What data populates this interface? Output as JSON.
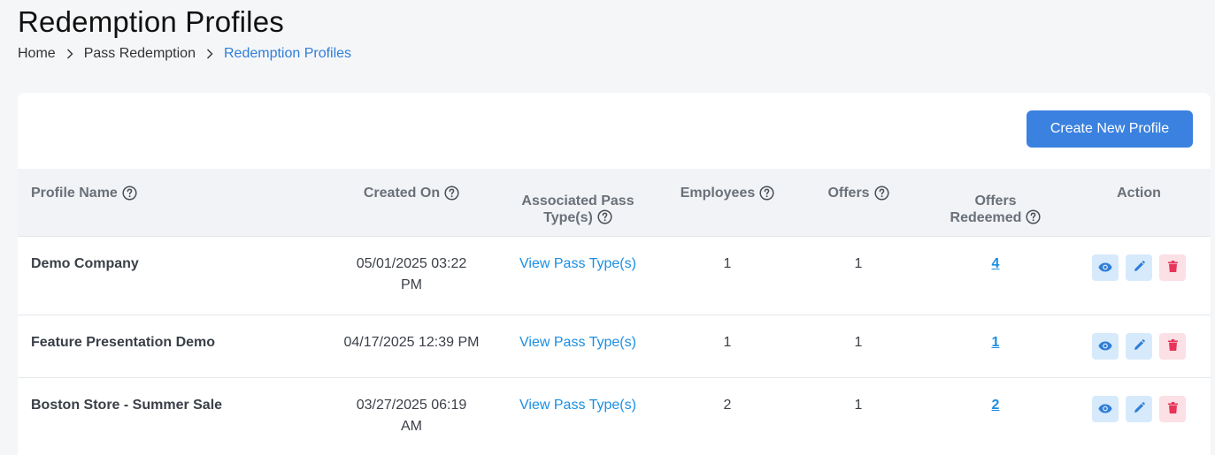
{
  "header": {
    "title": "Redemption Profiles",
    "breadcrumb": [
      "Home",
      "Pass Redemption",
      "Redemption Profiles"
    ]
  },
  "toolbar": {
    "create_label": "Create New Profile"
  },
  "table": {
    "columns": {
      "profile_name": "Profile Name",
      "created_on": "Created On",
      "associated_pass_line1": "Associated Pass",
      "associated_pass_line2": "Type(s)",
      "employees": "Employees",
      "offers": "Offers",
      "offers_redeemed_line1": "Offers",
      "offers_redeemed_line2": "Redeemed",
      "action": "Action"
    },
    "rows": [
      {
        "name": "Demo Company",
        "created_line1": "05/01/2025 03:22",
        "created_line2": "PM",
        "pass_link": "View Pass Type(s)",
        "employees": "1",
        "offers": "1",
        "redeemed": "4"
      },
      {
        "name": "Feature Presentation Demo",
        "created_line1": "04/17/2025 12:39 PM",
        "created_line2": "",
        "pass_link": "View Pass Type(s)",
        "employees": "1",
        "offers": "1",
        "redeemed": "1"
      },
      {
        "name": "Boston Store - Summer Sale",
        "created_line1": "03/27/2025 06:19",
        "created_line2": "AM",
        "pass_link": "View Pass Type(s)",
        "employees": "2",
        "offers": "1",
        "redeemed": "2"
      }
    ]
  },
  "colors": {
    "accent": "#3b82e0",
    "link": "#1a8fe3",
    "danger": "#e8345a",
    "header_bg": "#f1f3f6"
  },
  "icons": {
    "help": "help-circle-icon",
    "view": "eye-icon",
    "edit": "pencil-icon",
    "delete": "trash-icon",
    "separator": "chevron-right-icon"
  }
}
